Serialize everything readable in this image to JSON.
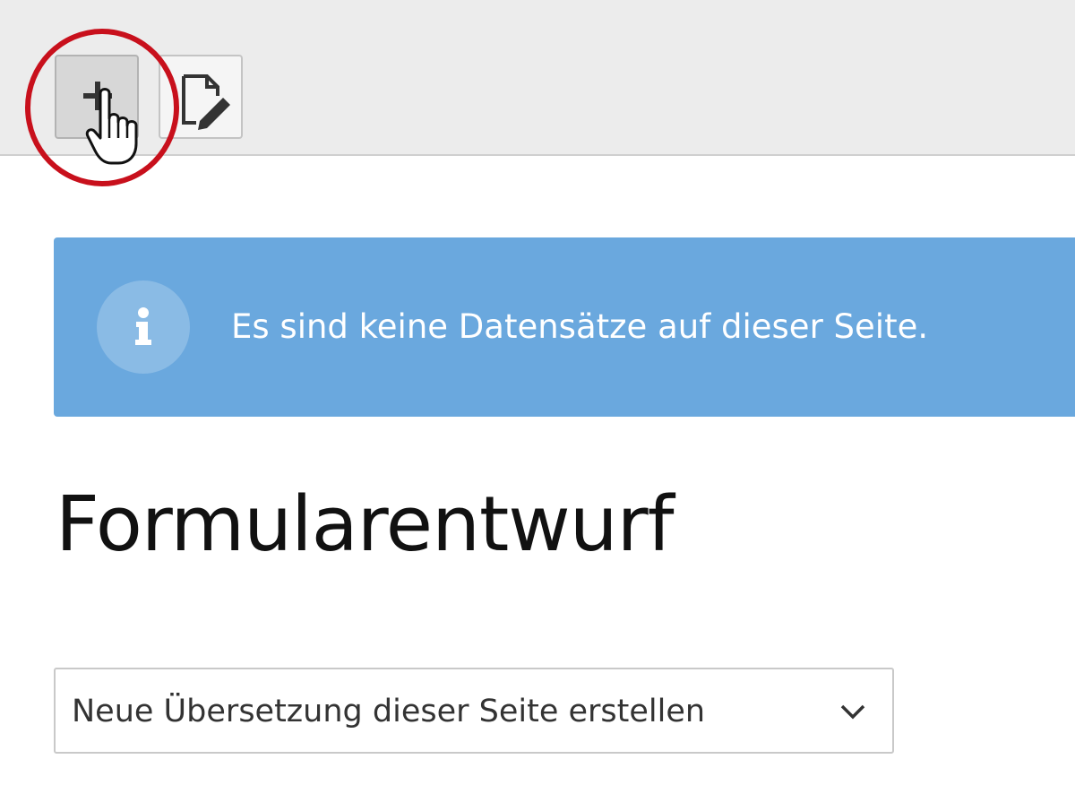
{
  "toolbar": {
    "buttons": [
      {
        "name": "add",
        "icon": "plus-icon"
      },
      {
        "name": "edit-page",
        "icon": "document-edit-icon"
      }
    ],
    "highlight_color": "#c8101c"
  },
  "info_callout": {
    "icon": "info-icon",
    "message": "Es sind keine Datensätze auf dieser Seite.",
    "background_color": "#6aa8de"
  },
  "page": {
    "title": "Formularentwurf"
  },
  "translation_select": {
    "selected_value": "Neue Übersetzung dieser Seite erstellen",
    "icon": "chevron-down-icon"
  }
}
